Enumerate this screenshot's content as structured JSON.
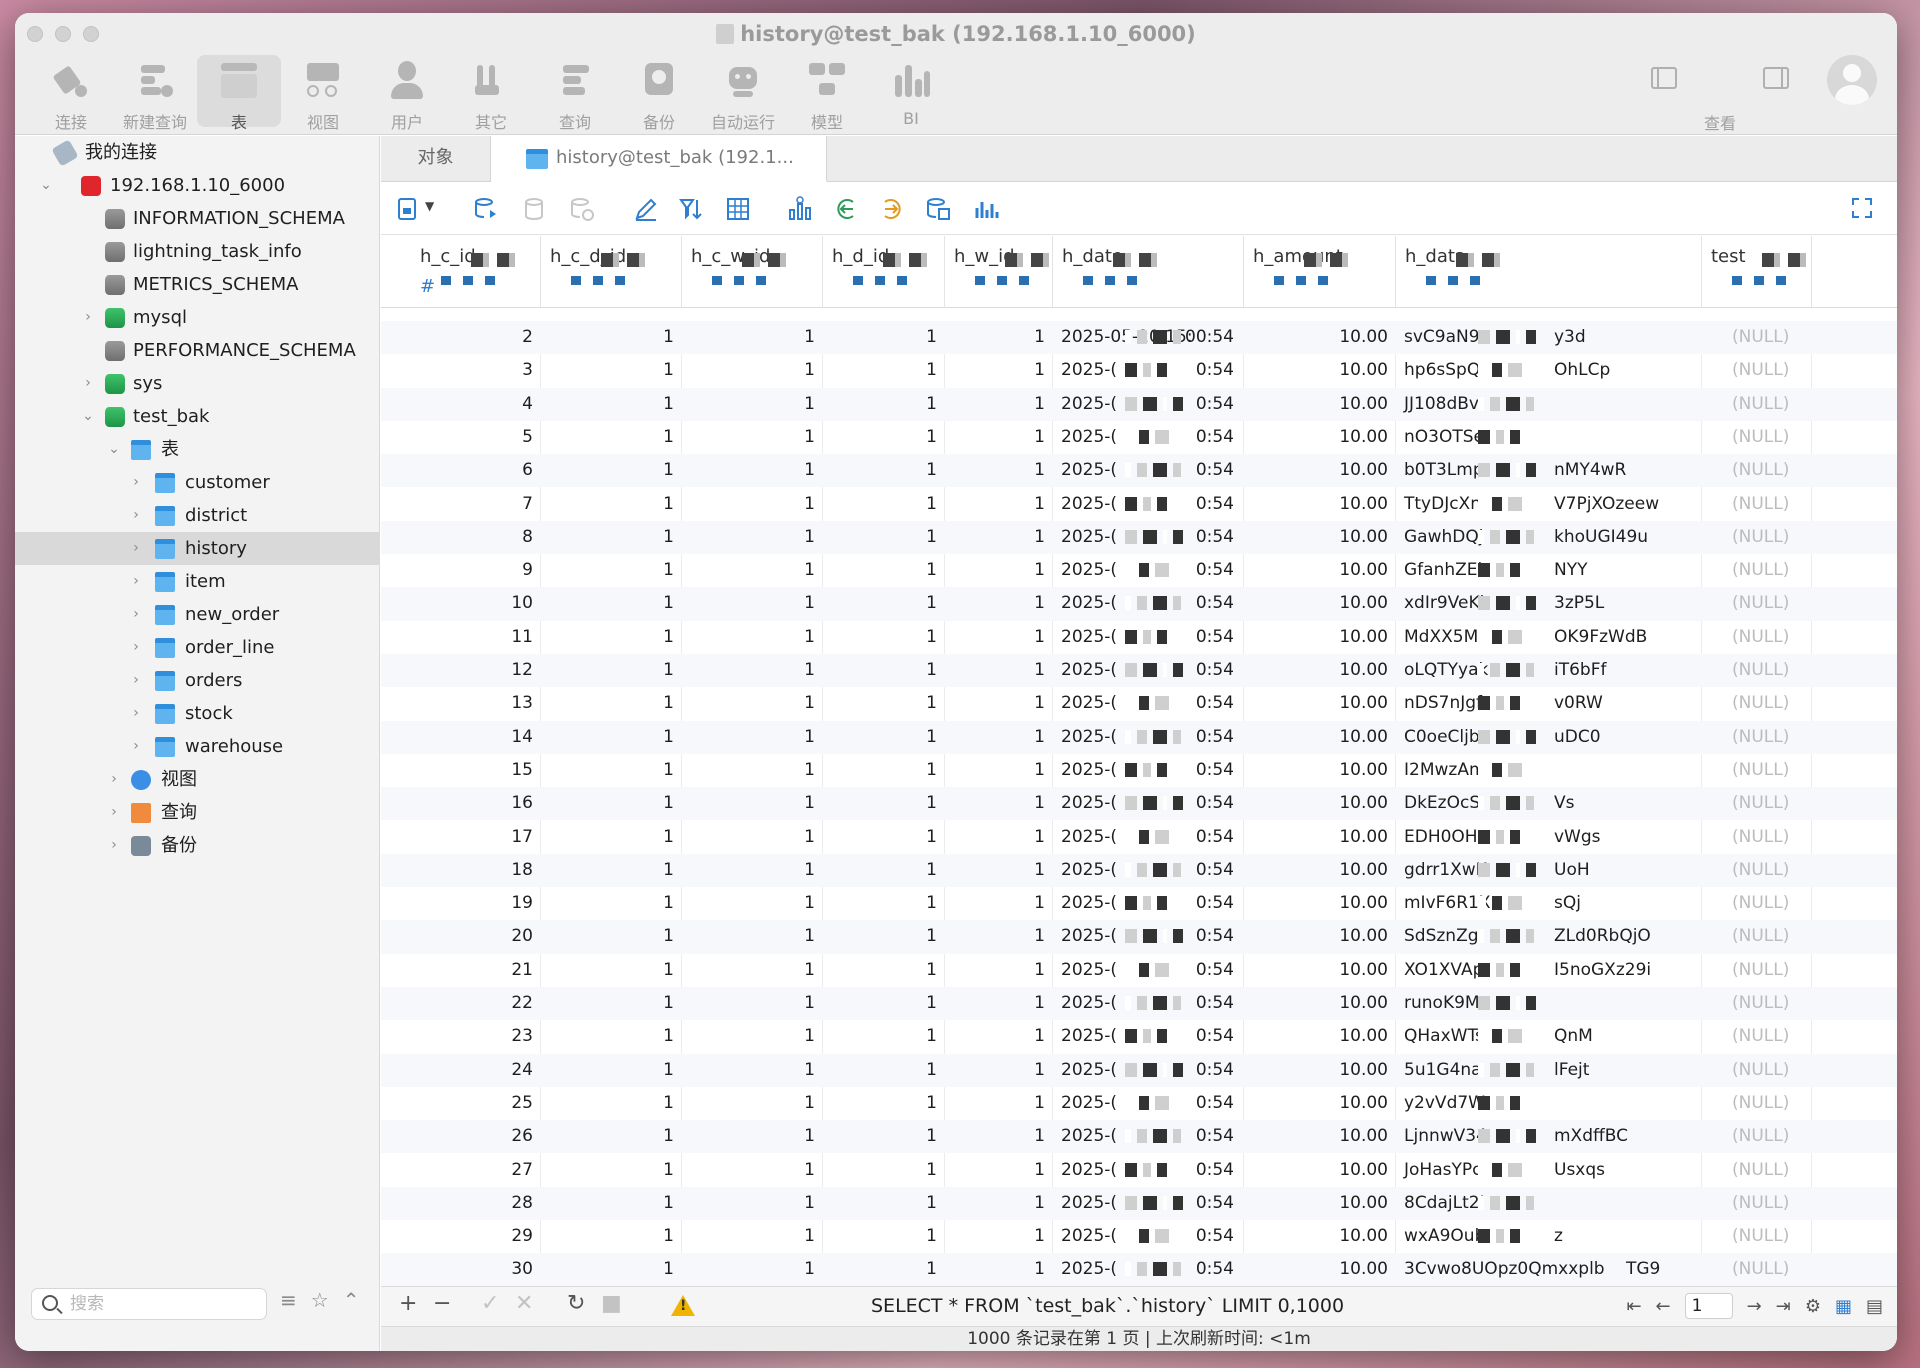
{
  "window": {
    "title": "history@test_bak (192.168.1.10_6000)"
  },
  "toolbar": {
    "items": [
      {
        "label": "连接",
        "icon": "plug-icon"
      },
      {
        "label": "新建查询",
        "icon": "new-query-icon"
      },
      {
        "label": "表",
        "icon": "table-icon",
        "active": true
      },
      {
        "label": "视图",
        "icon": "view-icon"
      },
      {
        "label": "用户",
        "icon": "user-icon"
      },
      {
        "label": "其它",
        "icon": "tools-icon"
      },
      {
        "label": "查询",
        "icon": "query-icon"
      },
      {
        "label": "备份",
        "icon": "backup-icon"
      },
      {
        "label": "自动运行",
        "icon": "robot-icon"
      },
      {
        "label": "模型",
        "icon": "model-icon"
      },
      {
        "label": "BI",
        "icon": "bi-chart-icon"
      }
    ],
    "view_label": "查看"
  },
  "sidebar": {
    "root_label": "我的连接",
    "connection_label": "192.168.1.10_6000",
    "databases": {
      "information_schema": "INFORMATION_SCHEMA",
      "lightning": "lightning_task_info",
      "metrics": "METRICS_SCHEMA",
      "mysql": "mysql",
      "performance": "PERFORMANCE_SCHEMA",
      "sys": "sys",
      "test_bak": "test_bak"
    },
    "tables_group": "表",
    "tables": [
      "customer",
      "district",
      "history",
      "item",
      "new_order",
      "order_line",
      "orders",
      "stock",
      "warehouse"
    ],
    "views_group": "视图",
    "queries_group": "查询",
    "backups_group": "备份",
    "search_placeholder": "搜索"
  },
  "tabs": {
    "objects": "对象",
    "history": "history@test_bak (192.1..."
  },
  "grid": {
    "columns": [
      {
        "name": "h_c_id",
        "type": "#"
      },
      {
        "name": "h_c_d_id",
        "type": ""
      },
      {
        "name": "h_c_w_id",
        "type": ""
      },
      {
        "name": "h_d_id",
        "type": ""
      },
      {
        "name": "h_w_id",
        "type": ""
      },
      {
        "name": "h_date",
        "type": ""
      },
      {
        "name": "h_amount",
        "type": ""
      },
      {
        "name": "h_data",
        "type": ""
      },
      {
        "name": "test",
        "type": ""
      }
    ],
    "rows": [
      {
        "c_id": "2",
        "d_id": "1",
        "w_id": "1",
        "hd": "1",
        "hw": "1",
        "date_a": "2025-05-20 15:",
        "date_b": "00:54",
        "amount": "10.00",
        "data_a": "svC9aN9v",
        "data_b": "y3d",
        "test": "(NULL)"
      },
      {
        "c_id": "3",
        "d_id": "1",
        "w_id": "1",
        "hd": "1",
        "hw": "1",
        "date_a": "2025-(",
        "date_b": "0:54",
        "amount": "10.00",
        "data_a": "hp6sSpQ:",
        "data_b": "OhLCp",
        "test": "(NULL)"
      },
      {
        "c_id": "4",
        "d_id": "1",
        "w_id": "1",
        "hd": "1",
        "hw": "1",
        "date_a": "2025-(",
        "date_b": "0:54",
        "amount": "10.00",
        "data_a": "JJ108dBv",
        "data_b": "",
        "test": "(NULL)"
      },
      {
        "c_id": "5",
        "d_id": "1",
        "w_id": "1",
        "hd": "1",
        "hw": "1",
        "date_a": "2025-(",
        "date_b": "0:54",
        "amount": "10.00",
        "data_a": "nO3OTSe",
        "data_b": "",
        "test": "(NULL)"
      },
      {
        "c_id": "6",
        "d_id": "1",
        "w_id": "1",
        "hd": "1",
        "hw": "1",
        "date_a": "2025-(",
        "date_b": "0:54",
        "amount": "10.00",
        "data_a": "b0T3Lmp",
        "data_b": "nMY4wR",
        "test": "(NULL)"
      },
      {
        "c_id": "7",
        "d_id": "1",
        "w_id": "1",
        "hd": "1",
        "hw": "1",
        "date_a": "2025-(",
        "date_b": "0:54",
        "amount": "10.00",
        "data_a": "TtyDJcXn",
        "data_b": "V7PjXOzeew",
        "test": "(NULL)"
      },
      {
        "c_id": "8",
        "d_id": "1",
        "w_id": "1",
        "hd": "1",
        "hw": "1",
        "date_a": "2025-(",
        "date_b": "0:54",
        "amount": "10.00",
        "data_a": "GawhDQj",
        "data_b": "khoUGI49u",
        "test": "(NULL)"
      },
      {
        "c_id": "9",
        "d_id": "1",
        "w_id": "1",
        "hd": "1",
        "hw": "1",
        "date_a": "2025-(",
        "date_b": "0:54",
        "amount": "10.00",
        "data_a": "GfanhZEi",
        "data_b": "NYY",
        "test": "(NULL)"
      },
      {
        "c_id": "10",
        "d_id": "1",
        "w_id": "1",
        "hd": "1",
        "hw": "1",
        "date_a": "2025-(",
        "date_b": "0:54",
        "amount": "10.00",
        "data_a": "xdIr9VeKl",
        "data_b": "3zP5L",
        "test": "(NULL)"
      },
      {
        "c_id": "11",
        "d_id": "1",
        "w_id": "1",
        "hd": "1",
        "hw": "1",
        "date_a": "2025-(",
        "date_b": "0:54",
        "amount": "10.00",
        "data_a": "MdXX5Mr",
        "data_b": "OK9FzWdB",
        "test": "(NULL)"
      },
      {
        "c_id": "12",
        "d_id": "1",
        "w_id": "1",
        "hd": "1",
        "hw": "1",
        "date_a": "2025-(",
        "date_b": "0:54",
        "amount": "10.00",
        "data_a": "oLQTYyak",
        "data_b": "iT6bFf",
        "test": "(NULL)"
      },
      {
        "c_id": "13",
        "d_id": "1",
        "w_id": "1",
        "hd": "1",
        "hw": "1",
        "date_a": "2025-(",
        "date_b": "0:54",
        "amount": "10.00",
        "data_a": "nDS7nJgf",
        "data_b": "v0RW",
        "test": "(NULL)"
      },
      {
        "c_id": "14",
        "d_id": "1",
        "w_id": "1",
        "hd": "1",
        "hw": "1",
        "date_a": "2025-(",
        "date_b": "0:54",
        "amount": "10.00",
        "data_a": "C0oeCljbt",
        "data_b": "uDC0",
        "test": "(NULL)"
      },
      {
        "c_id": "15",
        "d_id": "1",
        "w_id": "1",
        "hd": "1",
        "hw": "1",
        "date_a": "2025-(",
        "date_b": "0:54",
        "amount": "10.00",
        "data_a": "I2MwzAm",
        "data_b": "",
        "test": "(NULL)"
      },
      {
        "c_id": "16",
        "d_id": "1",
        "w_id": "1",
        "hd": "1",
        "hw": "1",
        "date_a": "2025-(",
        "date_b": "0:54",
        "amount": "10.00",
        "data_a": "DkEzOcS",
        "data_b": "Vs",
        "test": "(NULL)"
      },
      {
        "c_id": "17",
        "d_id": "1",
        "w_id": "1",
        "hd": "1",
        "hw": "1",
        "date_a": "2025-(",
        "date_b": "0:54",
        "amount": "10.00",
        "data_a": "EDH0OH",
        "data_b": "vWgs",
        "test": "(NULL)"
      },
      {
        "c_id": "18",
        "d_id": "1",
        "w_id": "1",
        "hd": "1",
        "hw": "1",
        "date_a": "2025-(",
        "date_b": "0:54",
        "amount": "10.00",
        "data_a": "gdrr1XwK",
        "data_b": "UoH",
        "test": "(NULL)"
      },
      {
        "c_id": "19",
        "d_id": "1",
        "w_id": "1",
        "hd": "1",
        "hw": "1",
        "date_a": "2025-(",
        "date_b": "0:54",
        "amount": "10.00",
        "data_a": "mIvF6R1X",
        "data_b": "sQj",
        "test": "(NULL)"
      },
      {
        "c_id": "20",
        "d_id": "1",
        "w_id": "1",
        "hd": "1",
        "hw": "1",
        "date_a": "2025-(",
        "date_b": "0:54",
        "amount": "10.00",
        "data_a": "SdSznZg",
        "data_b": "ZLd0RbQjO",
        "test": "(NULL)"
      },
      {
        "c_id": "21",
        "d_id": "1",
        "w_id": "1",
        "hd": "1",
        "hw": "1",
        "date_a": "2025-(",
        "date_b": "0:54",
        "amount": "10.00",
        "data_a": "XO1XVAp",
        "data_b": "I5noGXz29i",
        "test": "(NULL)"
      },
      {
        "c_id": "22",
        "d_id": "1",
        "w_id": "1",
        "hd": "1",
        "hw": "1",
        "date_a": "2025-(",
        "date_b": "0:54",
        "amount": "10.00",
        "data_a": "runoK9M",
        "data_b": "",
        "test": "(NULL)"
      },
      {
        "c_id": "23",
        "d_id": "1",
        "w_id": "1",
        "hd": "1",
        "hw": "1",
        "date_a": "2025-(",
        "date_b": "0:54",
        "amount": "10.00",
        "data_a": "QHaxWTs",
        "data_b": "QnM",
        "test": "(NULL)"
      },
      {
        "c_id": "24",
        "d_id": "1",
        "w_id": "1",
        "hd": "1",
        "hw": "1",
        "date_a": "2025-(",
        "date_b": "0:54",
        "amount": "10.00",
        "data_a": "5u1G4na",
        "data_b": "lFejt",
        "test": "(NULL)"
      },
      {
        "c_id": "25",
        "d_id": "1",
        "w_id": "1",
        "hd": "1",
        "hw": "1",
        "date_a": "2025-(",
        "date_b": "0:54",
        "amount": "10.00",
        "data_a": "y2vVd7W",
        "data_b": "",
        "test": "(NULL)"
      },
      {
        "c_id": "26",
        "d_id": "1",
        "w_id": "1",
        "hd": "1",
        "hw": "1",
        "date_a": "2025-(",
        "date_b": "0:54",
        "amount": "10.00",
        "data_a": "LjnnwV34",
        "data_b": "mXdffBC",
        "test": "(NULL)"
      },
      {
        "c_id": "27",
        "d_id": "1",
        "w_id": "1",
        "hd": "1",
        "hw": "1",
        "date_a": "2025-(",
        "date_b": "0:54",
        "amount": "10.00",
        "data_a": "JoHasYPc",
        "data_b": "Usxqs",
        "test": "(NULL)"
      },
      {
        "c_id": "28",
        "d_id": "1",
        "w_id": "1",
        "hd": "1",
        "hw": "1",
        "date_a": "2025-(",
        "date_b": "0:54",
        "amount": "10.00",
        "data_a": "8CdajLt2I",
        "data_b": "",
        "test": "(NULL)"
      },
      {
        "c_id": "29",
        "d_id": "1",
        "w_id": "1",
        "hd": "1",
        "hw": "1",
        "date_a": "2025-(",
        "date_b": "0:54",
        "amount": "10.00",
        "data_a": "wxA9Oub",
        "data_b": "z",
        "test": "(NULL)"
      },
      {
        "c_id": "30",
        "d_id": "1",
        "w_id": "1",
        "hd": "1",
        "hw": "1",
        "date_a": "2025-(",
        "date_b": "0:54",
        "amount": "10.00",
        "data_a": "3Cvwo8UOpz0Qmxxplb",
        "data_b": "TG9",
        "test": "(NULL)"
      }
    ]
  },
  "editbar": {
    "sql": "SELECT * FROM `test_bak`.`history` LIMIT 0,1000",
    "page": "1"
  },
  "status": {
    "text": "1000 条记录在第 1 页   |   上次刷新时间: <1m"
  },
  "colors": {
    "accent": "#2f7fd1",
    "null_text": "#bcbcbc",
    "selected_row": "#d9d9d9"
  }
}
